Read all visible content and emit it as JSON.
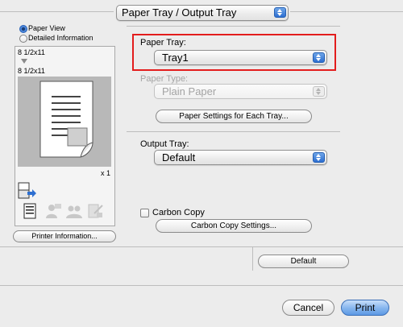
{
  "tab_popup": {
    "label": "Paper Tray / Output Tray"
  },
  "view_options": {
    "paper_view": "Paper View",
    "detailed_info": "Detailed Information"
  },
  "preview": {
    "source_size": "8 1/2x11",
    "output_size": "8 1/2x11",
    "copies": "x 1"
  },
  "printer_info_button": "Printer Information...",
  "paper_tray": {
    "label": "Paper Tray:",
    "value": "Tray1"
  },
  "paper_type": {
    "label": "Paper Type:",
    "value": "Plain Paper"
  },
  "paper_settings_button": "Paper Settings for Each Tray...",
  "output_tray": {
    "label": "Output Tray:",
    "value": "Default"
  },
  "carbon_copy": {
    "label": "Carbon Copy",
    "checked": false
  },
  "carbon_copy_settings_button": "Carbon Copy Settings...",
  "default_button": "Default",
  "cancel_button": "Cancel",
  "print_button": "Print",
  "colors": {
    "highlight_border": "#e31d1d",
    "accent_blue": "#2d6fd1"
  }
}
